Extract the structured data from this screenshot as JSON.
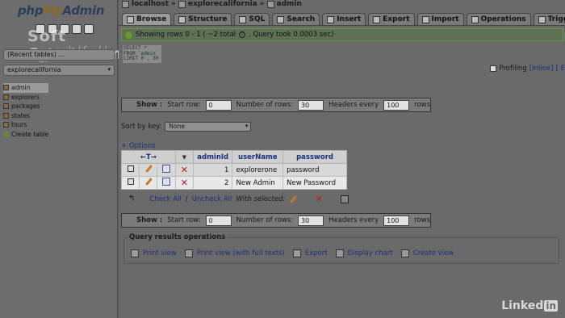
{
  "left": {
    "logo_php": "php",
    "logo_my": "My",
    "logo_admin": "Admin",
    "watermark": "Soft Cozar.com",
    "watermark_sub": "اولین کتابخانه ترجمه آنلاین",
    "recent_tables": "(Recent tables) ...",
    "database": "explorecalifornia",
    "tables": [
      "admin",
      "explorers",
      "packages",
      "states",
      "tours"
    ],
    "active_table": "admin",
    "create_table": "Create table"
  },
  "breadcrumb": {
    "server": "localhost",
    "database": "explorecalifornia",
    "table": "admin",
    "sep": "»"
  },
  "tabs": [
    {
      "label": "Browse",
      "active": true
    },
    {
      "label": "Structure",
      "active": false
    },
    {
      "label": "SQL",
      "active": false
    },
    {
      "label": "Search",
      "active": false
    },
    {
      "label": "Insert",
      "active": false
    },
    {
      "label": "Export",
      "active": false
    },
    {
      "label": "Import",
      "active": false
    },
    {
      "label": "Operations",
      "active": false
    },
    {
      "label": "Triggers",
      "active": false
    }
  ],
  "notice": {
    "text_a": "Showing rows 0 - 1 ( ~2 total",
    "text_b": ", Query took 0.0003 sec)"
  },
  "sql_preview": {
    "line1": "SELECT *",
    "line2": "FROM `admin`",
    "line3": "LIMIT 0 , 30"
  },
  "profiling": {
    "label": "Profiling",
    "inline": "[Inline]",
    "edit": "[ E"
  },
  "show_bar": {
    "show_label": "Show :",
    "start_row_label": "Start row:",
    "start_row_value": "0",
    "num_rows_label": "Number of rows:",
    "num_rows_value": "30",
    "headers_label": "Headers every",
    "headers_value": "100",
    "rows_label": "rows"
  },
  "sort": {
    "label": "Sort by key:",
    "value": "None"
  },
  "options_label": "+ Options",
  "table": {
    "nav_arrows": "←T→",
    "columns": [
      "adminId",
      "userName",
      "password"
    ],
    "rows": [
      {
        "adminId": "1",
        "userName": "explorerone",
        "password": "password"
      },
      {
        "adminId": "2",
        "userName": "New Admin",
        "password": "New Password"
      }
    ]
  },
  "with_selected": {
    "check_all": "Check All",
    "separator": " / ",
    "uncheck_all": "Uncheck All",
    "label": "With selected:"
  },
  "query_results": {
    "legend": "Query results operations",
    "print_view": "Print view",
    "print_full": "Print view (with full texts)",
    "export": "Export",
    "display_chart": "Display chart",
    "create_view": "Create view"
  },
  "linkedin": {
    "brand": "Linked",
    "in": "in"
  }
}
